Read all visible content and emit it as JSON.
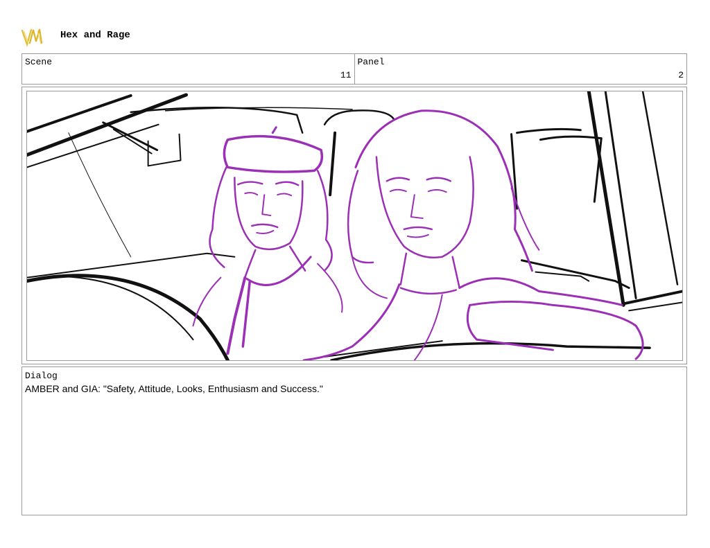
{
  "header": {
    "project_title": "Hex and Rage"
  },
  "info": {
    "scene_label": "Scene",
    "scene_number": "11",
    "panel_label": "Panel",
    "panel_number": "2"
  },
  "panel": {
    "ink_color": "#000000",
    "character_color": "#9b2fb5"
  },
  "dialog": {
    "label": "Dialog",
    "text": "AMBER and GIA: \"Safety, Attitude, Looks, Enthusiasm and Success.\""
  },
  "colors": {
    "border": "#9a9a9a",
    "logo_gold": "#e2c13a"
  }
}
